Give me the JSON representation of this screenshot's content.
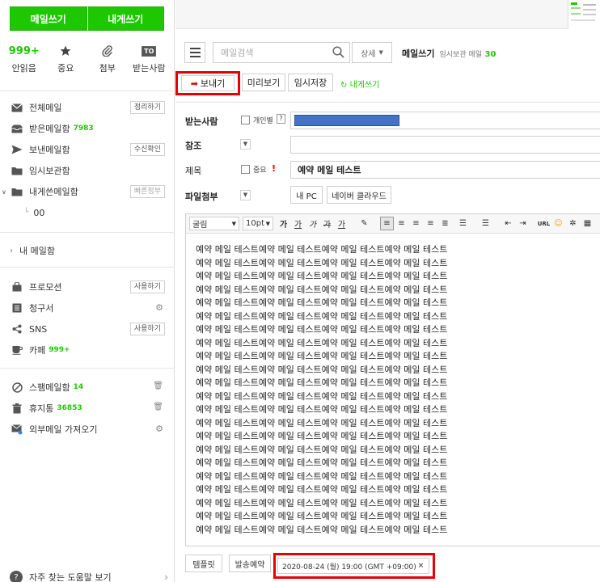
{
  "sidebar": {
    "compose_label": "메일쓰기",
    "self_compose_label": "내게쓰기",
    "quick": [
      {
        "value": "999+",
        "label": "안읽음",
        "icon": "unread-count"
      },
      {
        "value": "",
        "label": "중요",
        "icon": "star-icon"
      },
      {
        "value": "",
        "label": "첨부",
        "icon": "paperclip-icon"
      },
      {
        "value": "TO",
        "label": "받는사람",
        "icon": "to-icon"
      }
    ],
    "folders": {
      "all": {
        "label": "전체메일",
        "action": "정리하기"
      },
      "inbox": {
        "label": "받은메일함",
        "count": "7983"
      },
      "sent": {
        "label": "보낸메일함",
        "action": "수신확인"
      },
      "drafts": {
        "label": "임시보관함"
      },
      "self": {
        "label": "내게쓴메일함",
        "action": "빠른정부"
      },
      "sub00": {
        "label": "00"
      }
    },
    "my_mailbox": "내 메일함",
    "services": {
      "promo": {
        "label": "프로모션",
        "action": "사용하기"
      },
      "bill": {
        "label": "청구서"
      },
      "sns": {
        "label": "SNS",
        "action": "사용하기"
      },
      "cafe": {
        "label": "카페",
        "count": "999+"
      }
    },
    "extras": {
      "spam": {
        "label": "스팸메일함",
        "count": "14"
      },
      "trash": {
        "label": "휴지통",
        "count": "36853"
      },
      "external": {
        "label": "외부메일 가져오기"
      }
    },
    "help": "자주 찾는 도움말 보기"
  },
  "main": {
    "search_placeholder": "메일검색",
    "detail_label": "상세",
    "title": "메일쓰기",
    "drafts_label": "임시보관 메일",
    "drafts_count": "30",
    "actions": {
      "send": "보내기",
      "preview": "미리보기",
      "save_draft": "임시저장",
      "self_send": "내게쓰기"
    },
    "form": {
      "to_label": "받는사람",
      "individual_label": "개인별",
      "help_mark": "?",
      "cc_label": "참조",
      "subject_label": "제목",
      "important_label": "중요",
      "important_mark": "!",
      "subject_value": "예약 메일 테스트",
      "attach_label": "파일첨부",
      "my_pc": "내 PC",
      "naver_cloud": "네이버 클라우드"
    },
    "toolbar": {
      "font": "굴림",
      "size": "10pt",
      "bold": "가",
      "italic": "가",
      "underline": "가",
      "strike": "가",
      "color": "가"
    },
    "body_lines": [
      "예약 메일 테스트예약 메일 테스트예약 메일 테스트예약 메일 테스트",
      "예약 메일 테스트예약 메일 테스트예약 메일 테스트예약 메일 테스트",
      "예약 메일 테스트예약 메일 테스트예약 메일 테스트예약 메일 테스트",
      "예약 메일 테스트예약 메일 테스트예약 메일 테스트예약 메일 테스트",
      "예약 메일 테스트예약 메일 테스트예약 메일 테스트예약 메일 테스트",
      "예약 메일 테스트예약 메일 테스트예약 메일 테스트예약 메일 테스트",
      "예약 메일 테스트예약 메일 테스트예약 메일 테스트예약 메일 테스트",
      "예약 메일 테스트예약 메일 테스트예약 메일 테스트예약 메일 테스트",
      "예약 메일 테스트예약 메일 테스트예약 메일 테스트예약 메일 테스트",
      "예약 메일 테스트예약 메일 테스트예약 메일 테스트예약 메일 테스트",
      "예약 메일 테스트예약 메일 테스트예약 메일 테스트예약 메일 테스트",
      "예약 메일 테스트예약 메일 테스트예약 메일 테스트예약 메일 테스트",
      "예약 메일 테스트예약 메일 테스트예약 메일 테스트예약 메일 테스트",
      "예약 메일 테스트예약 메일 테스트예약 메일 테스트예약 메일 테스트",
      "예약 메일 테스트예약 메일 테스트예약 메일 테스트예약 메일 테스트",
      "예약 메일 테스트예약 메일 테스트예약 메일 테스트예약 메일 테스트",
      "예약 메일 테스트예약 메일 테스트예약 메일 테스트예약 메일 테스트",
      "예약 메일 테스트예약 메일 테스트예약 메일 테스트예약 메일 테스트",
      "예약 메일 테스트예약 메일 테스트예약 메일 테스트예약 메일 테스트",
      "예약 메일 테스트예약 메일 테스트예약 메일 테스트예약 메일 테스트",
      "예약 메일 테스트예약 메일 테스트예약 메일 테스트예약 메일 테스트",
      "예약 메일 테스트예약 메일 테스트예약 메일 테스트예약 메일 테스트"
    ],
    "bottom": {
      "template": "템플릿",
      "schedule": "발송예약",
      "scheduled_time": "2020-08-24 (월) 19:00 (GMT +09:00)",
      "remove_mark": "×"
    }
  },
  "colors": {
    "brand": "#1ec800",
    "highlight": "#e60000",
    "recipient_chip": "#4472c4"
  }
}
